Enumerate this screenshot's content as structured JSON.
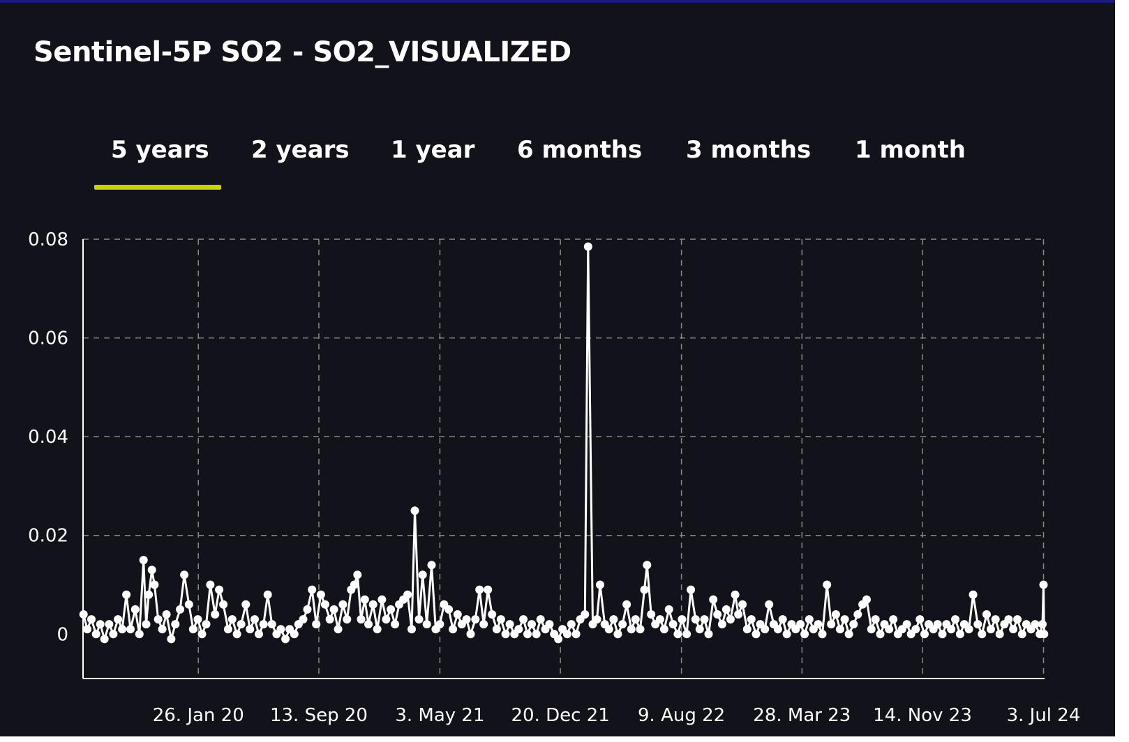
{
  "title": "Sentinel-5P SO2 - SO2_VISUALIZED",
  "tabs": [
    {
      "label": "5 years",
      "active": true
    },
    {
      "label": "2 years",
      "active": false
    },
    {
      "label": "1 year",
      "active": false
    },
    {
      "label": "6 months",
      "active": false
    },
    {
      "label": "3 months",
      "active": false
    },
    {
      "label": "1 month",
      "active": false
    }
  ],
  "colors": {
    "background": "#12121a",
    "series": "#ffffff",
    "grid": "#8a8a8a",
    "tab_accent": "#c8d400"
  },
  "chart_data": {
    "type": "line",
    "title": "",
    "xlabel": "",
    "ylabel": "",
    "x_range": [
      "2019-06-19",
      "2024-07-05"
    ],
    "ylim": [
      -0.009,
      0.08
    ],
    "y_ticks": [
      0,
      0.02,
      0.04,
      0.06,
      0.08
    ],
    "y_tick_labels": [
      "0",
      "0.02",
      "0.04",
      "0.06",
      "0.08"
    ],
    "x_ticks": [
      "2020-01-26",
      "2020-09-13",
      "2021-05-03",
      "2021-12-20",
      "2022-08-09",
      "2023-03-28",
      "2023-11-14",
      "2024-07-03"
    ],
    "x_tick_labels": [
      "26. Jan 20",
      "13. Sep 20",
      "3. May 21",
      "20. Dec 21",
      "9. Aug 22",
      "28. Mar 23",
      "14. Nov 23",
      "3. Jul 24"
    ],
    "grid": true,
    "legend": "none",
    "marker": "circle",
    "series": [
      {
        "values_note": "",
        "points": [
          [
            "2019-06-20",
            0.004
          ],
          [
            "2019-06-27",
            0.001
          ],
          [
            "2019-07-05",
            0.003
          ],
          [
            "2019-07-14",
            0.0
          ],
          [
            "2019-07-22",
            0.002
          ],
          [
            "2019-07-30",
            -0.001
          ],
          [
            "2019-08-08",
            0.002
          ],
          [
            "2019-08-16",
            0.0
          ],
          [
            "2019-08-25",
            0.003
          ],
          [
            "2019-09-02",
            0.001
          ],
          [
            "2019-09-10",
            0.008
          ],
          [
            "2019-09-18",
            0.001
          ],
          [
            "2019-09-27",
            0.005
          ],
          [
            "2019-10-05",
            0.0
          ],
          [
            "2019-10-13",
            0.015
          ],
          [
            "2019-10-18",
            0.002
          ],
          [
            "2019-10-23",
            0.008
          ],
          [
            "2019-10-29",
            0.013
          ],
          [
            "2019-11-03",
            0.01
          ],
          [
            "2019-11-10",
            0.003
          ],
          [
            "2019-11-18",
            0.001
          ],
          [
            "2019-11-26",
            0.004
          ],
          [
            "2019-12-05",
            -0.001
          ],
          [
            "2019-12-13",
            0.002
          ],
          [
            "2019-12-22",
            0.005
          ],
          [
            "2019-12-30",
            0.012
          ],
          [
            "2020-01-08",
            0.006
          ],
          [
            "2020-01-16",
            0.001
          ],
          [
            "2020-01-25",
            0.003
          ],
          [
            "2020-02-02",
            0.0
          ],
          [
            "2020-02-10",
            0.002
          ],
          [
            "2020-02-18",
            0.01
          ],
          [
            "2020-02-27",
            0.004
          ],
          [
            "2020-03-06",
            0.009
          ],
          [
            "2020-03-14",
            0.006
          ],
          [
            "2020-03-23",
            0.001
          ],
          [
            "2020-03-31",
            0.003
          ],
          [
            "2020-04-09",
            0.0
          ],
          [
            "2020-04-17",
            0.002
          ],
          [
            "2020-04-26",
            0.006
          ],
          [
            "2020-05-04",
            0.001
          ],
          [
            "2020-05-13",
            0.003
          ],
          [
            "2020-05-21",
            0.0
          ],
          [
            "2020-05-30",
            0.002
          ],
          [
            "2020-06-07",
            0.008
          ],
          [
            "2020-06-15",
            0.002
          ],
          [
            "2020-06-24",
            0.0
          ],
          [
            "2020-07-02",
            0.001
          ],
          [
            "2020-07-11",
            -0.001
          ],
          [
            "2020-07-19",
            0.001
          ],
          [
            "2020-07-28",
            0.0
          ],
          [
            "2020-08-05",
            0.002
          ],
          [
            "2020-08-14",
            0.003
          ],
          [
            "2020-08-22",
            0.005
          ],
          [
            "2020-08-31",
            0.009
          ],
          [
            "2020-09-08",
            0.002
          ],
          [
            "2020-09-17",
            0.008
          ],
          [
            "2020-09-25",
            0.006
          ],
          [
            "2020-10-04",
            0.003
          ],
          [
            "2020-10-12",
            0.005
          ],
          [
            "2020-10-20",
            0.001
          ],
          [
            "2020-10-29",
            0.006
          ],
          [
            "2020-11-06",
            0.003
          ],
          [
            "2020-11-14",
            0.009
          ],
          [
            "2020-11-20",
            0.01
          ],
          [
            "2020-11-26",
            0.012
          ],
          [
            "2020-12-03",
            0.003
          ],
          [
            "2020-12-10",
            0.007
          ],
          [
            "2020-12-17",
            0.002
          ],
          [
            "2020-12-26",
            0.006
          ],
          [
            "2021-01-03",
            0.001
          ],
          [
            "2021-01-12",
            0.007
          ],
          [
            "2021-01-20",
            0.003
          ],
          [
            "2021-01-29",
            0.005
          ],
          [
            "2021-02-06",
            0.002
          ],
          [
            "2021-02-14",
            0.006
          ],
          [
            "2021-02-22",
            0.007
          ],
          [
            "2021-03-02",
            0.008
          ],
          [
            "2021-03-10",
            0.001
          ],
          [
            "2021-03-16",
            0.025
          ],
          [
            "2021-03-24",
            0.003
          ],
          [
            "2021-03-31",
            0.012
          ],
          [
            "2021-04-08",
            0.002
          ],
          [
            "2021-04-17",
            0.014
          ],
          [
            "2021-04-25",
            0.001
          ],
          [
            "2021-05-03",
            0.002
          ],
          [
            "2021-05-11",
            0.006
          ],
          [
            "2021-05-20",
            0.005
          ],
          [
            "2021-05-28",
            0.001
          ],
          [
            "2021-06-06",
            0.004
          ],
          [
            "2021-06-14",
            0.002
          ],
          [
            "2021-06-23",
            0.003
          ],
          [
            "2021-07-01",
            0.0
          ],
          [
            "2021-07-10",
            0.003
          ],
          [
            "2021-07-18",
            0.009
          ],
          [
            "2021-07-26",
            0.002
          ],
          [
            "2021-08-03",
            0.009
          ],
          [
            "2021-08-11",
            0.004
          ],
          [
            "2021-08-20",
            0.001
          ],
          [
            "2021-08-28",
            0.003
          ],
          [
            "2021-09-06",
            0.0
          ],
          [
            "2021-09-14",
            0.002
          ],
          [
            "2021-09-23",
            0.0
          ],
          [
            "2021-10-01",
            0.001
          ],
          [
            "2021-10-10",
            0.003
          ],
          [
            "2021-10-18",
            0.0
          ],
          [
            "2021-10-26",
            0.002
          ],
          [
            "2021-11-04",
            0.0
          ],
          [
            "2021-11-12",
            0.003
          ],
          [
            "2021-11-21",
            0.001
          ],
          [
            "2021-11-29",
            0.002
          ],
          [
            "2021-12-08",
            0.0
          ],
          [
            "2021-12-16",
            -0.001
          ],
          [
            "2021-12-24",
            0.001
          ],
          [
            "2022-01-02",
            0.0
          ],
          [
            "2022-01-10",
            0.002
          ],
          [
            "2022-01-19",
            0.0
          ],
          [
            "2022-01-27",
            0.003
          ],
          [
            "2022-02-05",
            0.004
          ],
          [
            "2022-02-11",
            0.0785
          ],
          [
            "2022-02-20",
            0.002
          ],
          [
            "2022-02-28",
            0.003
          ],
          [
            "2022-03-06",
            0.01
          ],
          [
            "2022-03-15",
            0.002
          ],
          [
            "2022-03-23",
            0.001
          ],
          [
            "2022-04-01",
            0.003
          ],
          [
            "2022-04-09",
            0.0
          ],
          [
            "2022-04-18",
            0.002
          ],
          [
            "2022-04-26",
            0.006
          ],
          [
            "2022-05-05",
            0.001
          ],
          [
            "2022-05-13",
            0.003
          ],
          [
            "2022-05-22",
            0.001
          ],
          [
            "2022-05-30",
            0.009
          ],
          [
            "2022-06-04",
            0.014
          ],
          [
            "2022-06-12",
            0.004
          ],
          [
            "2022-06-20",
            0.002
          ],
          [
            "2022-06-29",
            0.003
          ],
          [
            "2022-07-07",
            0.001
          ],
          [
            "2022-07-16",
            0.005
          ],
          [
            "2022-07-24",
            0.002
          ],
          [
            "2022-08-02",
            0.0
          ],
          [
            "2022-08-10",
            0.003
          ],
          [
            "2022-08-19",
            0.0
          ],
          [
            "2022-08-27",
            0.009
          ],
          [
            "2022-09-05",
            0.003
          ],
          [
            "2022-09-13",
            0.001
          ],
          [
            "2022-09-22",
            0.003
          ],
          [
            "2022-09-30",
            0.0
          ],
          [
            "2022-10-09",
            0.007
          ],
          [
            "2022-10-17",
            0.004
          ],
          [
            "2022-10-26",
            0.002
          ],
          [
            "2022-11-03",
            0.005
          ],
          [
            "2022-11-11",
            0.003
          ],
          [
            "2022-11-20",
            0.008
          ],
          [
            "2022-11-26",
            0.004
          ],
          [
            "2022-12-04",
            0.006
          ],
          [
            "2022-12-13",
            0.001
          ],
          [
            "2022-12-21",
            0.003
          ],
          [
            "2022-12-30",
            0.0
          ],
          [
            "2023-01-07",
            0.002
          ],
          [
            "2023-01-16",
            0.001
          ],
          [
            "2023-01-24",
            0.006
          ],
          [
            "2023-02-02",
            0.002
          ],
          [
            "2023-02-10",
            0.001
          ],
          [
            "2023-02-19",
            0.003
          ],
          [
            "2023-02-27",
            0.0
          ],
          [
            "2023-03-08",
            0.002
          ],
          [
            "2023-03-16",
            0.001
          ],
          [
            "2023-03-25",
            0.002
          ],
          [
            "2023-04-02",
            0.0
          ],
          [
            "2023-04-11",
            0.003
          ],
          [
            "2023-04-19",
            0.001
          ],
          [
            "2023-04-28",
            0.002
          ],
          [
            "2023-05-06",
            0.0
          ],
          [
            "2023-05-15",
            0.01
          ],
          [
            "2023-05-23",
            0.002
          ],
          [
            "2023-06-01",
            0.004
          ],
          [
            "2023-06-09",
            0.001
          ],
          [
            "2023-06-18",
            0.003
          ],
          [
            "2023-06-26",
            0.0
          ],
          [
            "2023-07-05",
            0.002
          ],
          [
            "2023-07-13",
            0.004
          ],
          [
            "2023-07-22",
            0.006
          ],
          [
            "2023-07-30",
            0.007
          ],
          [
            "2023-08-08",
            0.001
          ],
          [
            "2023-08-16",
            0.003
          ],
          [
            "2023-08-25",
            0.0
          ],
          [
            "2023-09-02",
            0.002
          ],
          [
            "2023-09-11",
            0.001
          ],
          [
            "2023-09-19",
            0.003
          ],
          [
            "2023-09-28",
            0.0
          ],
          [
            "2023-10-06",
            0.001
          ],
          [
            "2023-10-15",
            0.002
          ],
          [
            "2023-10-23",
            0.0
          ],
          [
            "2023-11-01",
            0.001
          ],
          [
            "2023-11-09",
            0.003
          ],
          [
            "2023-11-18",
            0.0
          ],
          [
            "2023-11-26",
            0.002
          ],
          [
            "2023-12-05",
            0.001
          ],
          [
            "2023-12-13",
            0.002
          ],
          [
            "2023-12-22",
            0.0
          ],
          [
            "2023-12-30",
            0.002
          ],
          [
            "2024-01-08",
            0.001
          ],
          [
            "2024-01-16",
            0.003
          ],
          [
            "2024-01-25",
            0.0
          ],
          [
            "2024-02-02",
            0.002
          ],
          [
            "2024-02-11",
            0.001
          ],
          [
            "2024-02-19",
            0.008
          ],
          [
            "2024-02-28",
            0.002
          ],
          [
            "2024-03-07",
            0.0
          ],
          [
            "2024-03-16",
            0.004
          ],
          [
            "2024-03-24",
            0.001
          ],
          [
            "2024-04-02",
            0.003
          ],
          [
            "2024-04-10",
            0.0
          ],
          [
            "2024-04-19",
            0.002
          ],
          [
            "2024-04-27",
            0.003
          ],
          [
            "2024-05-06",
            0.001
          ],
          [
            "2024-05-14",
            0.003
          ],
          [
            "2024-05-23",
            0.0
          ],
          [
            "2024-05-31",
            0.002
          ],
          [
            "2024-06-09",
            0.001
          ],
          [
            "2024-06-17",
            0.002
          ],
          [
            "2024-06-26",
            0.0
          ],
          [
            "2024-07-01",
            0.002
          ],
          [
            "2024-07-03",
            0.01
          ],
          [
            "2024-07-04",
            0.0
          ]
        ]
      }
    ]
  }
}
